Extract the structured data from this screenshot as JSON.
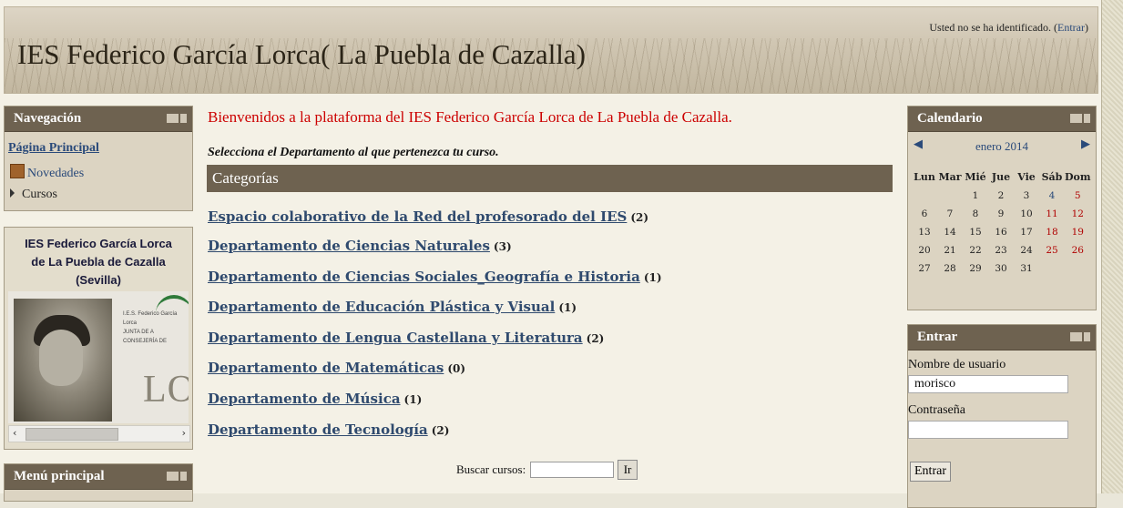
{
  "header": {
    "site_title": "IES Federico García Lorca( La Puebla de Cazalla)",
    "login_status_prefix": "Usted no se ha identificado. (",
    "login_link": "Entrar",
    "login_status_suffix": ")"
  },
  "nav_block": {
    "title": "Navegación",
    "items": [
      {
        "label": "Página Principal",
        "icon": null
      },
      {
        "label": "Novedades",
        "icon": "forum-icon"
      },
      {
        "label": "Cursos",
        "icon": "expand-triangle-icon"
      }
    ]
  },
  "school_block": {
    "name_line1": "IES Federico García Lorca",
    "name_line2": "de La Puebla de Cazalla",
    "name_line3": "(Sevilla)",
    "logo_text_line1": "I.E.S. Federico García Lorca",
    "logo_text_line2": "JUNTA DE A",
    "logo_text_line3": "CONSEJERÍA DE",
    "big_letters": "LOI"
  },
  "main_menu_block": {
    "title": "Menú principal"
  },
  "main": {
    "welcome": "Bienvenidos a la plataforma del IES Federico García Lorca de La Puebla de Cazalla.",
    "select_prompt": "Selecciona el Departamento al que pertenezca tu curso.",
    "categories_title": "Categorías",
    "categories": [
      {
        "name": "Espacio colaborativo de la Red del profesorado del IES",
        "count": "(2)"
      },
      {
        "name": "Departamento de Ciencias Naturales",
        "count": "(3)"
      },
      {
        "name": "Departamento de Ciencias Sociales_Geografía e Historia",
        "count": "(1)"
      },
      {
        "name": "Departamento de Educación Plástica y Visual",
        "count": "(1)"
      },
      {
        "name": "Departamento de Lengua Castellana y Literatura",
        "count": "(2)"
      },
      {
        "name": "Departamento de Matemáticas",
        "count": "(0)"
      },
      {
        "name": "Departamento de Música",
        "count": "(1)"
      },
      {
        "name": "Departamento de Tecnología",
        "count": "(2)"
      }
    ],
    "search_label": "Buscar cursos:",
    "search_value": "",
    "search_button": "Ir"
  },
  "calendar": {
    "title": "Calendario",
    "month": "enero 2014",
    "prev_icon": "arrow-left-icon",
    "next_icon": "arrow-right-icon",
    "weekdays": [
      "Lun",
      "Mar",
      "Mié",
      "Jue",
      "Vie",
      "Sáb",
      "Dom"
    ],
    "weeks": [
      [
        "",
        "",
        "1",
        "2",
        "3",
        "4",
        "5"
      ],
      [
        "6",
        "7",
        "8",
        "9",
        "10",
        "11",
        "12"
      ],
      [
        "13",
        "14",
        "15",
        "16",
        "17",
        "18",
        "19"
      ],
      [
        "20",
        "21",
        "22",
        "23",
        "24",
        "25",
        "26"
      ],
      [
        "27",
        "28",
        "29",
        "30",
        "31",
        "",
        ""
      ]
    ],
    "colors": {
      "saturday_first": "#2a4a7a",
      "weekend": "#b00000"
    }
  },
  "login_block": {
    "title": "Entrar",
    "username_label": "Nombre de usuario",
    "username_value": "morisco",
    "password_label": "Contraseña",
    "password_value": "",
    "submit_label": "Entrar"
  },
  "colors": {
    "block_header_bg": "#6e6250",
    "link": "#2f4a6e",
    "welcome": "#cc0000"
  }
}
